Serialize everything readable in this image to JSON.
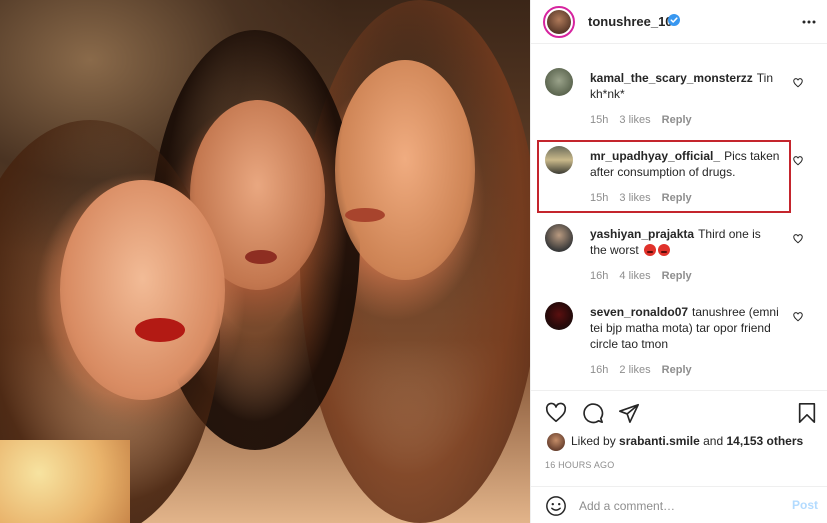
{
  "post": {
    "username": "tonushree_10",
    "verified": true
  },
  "comments": [
    {
      "username": "kamal_the_scary_monsterzz",
      "text": "Tin kh*nk*",
      "time": "15h",
      "likes": "3 likes",
      "reply": "Reply"
    },
    {
      "username": "mr_upadhyay_official_",
      "text": "Pics taken after consumption of drugs.",
      "time": "15h",
      "likes": "3 likes",
      "reply": "Reply"
    },
    {
      "username": "yashiyan_prajakta",
      "text": "Third one is the worst",
      "emoji": "angry-face-emoji x2",
      "time": "16h",
      "likes": "4 likes",
      "reply": "Reply"
    },
    {
      "username": "seven_ronaldo07",
      "text": "tanushree (emni tei bjp matha mota) tar opor friend circle tao tmon",
      "time": "16h",
      "likes": "2 likes",
      "reply": "Reply"
    }
  ],
  "likes": {
    "prefix": "Liked by",
    "user": "srabanti.smile",
    "and": "and",
    "others": "14,153 others"
  },
  "timestamp": "16 HOURS AGO",
  "add_comment": {
    "placeholder": "Add a comment…",
    "post_label": "Post"
  },
  "colors": {
    "highlight_box": "#c4252d",
    "verified_blue": "#3897f0",
    "post_button_disabled": "#b3dbff",
    "meta_gray": "#8e8e8e"
  },
  "icons": {
    "header": [
      "verified-badge-icon",
      "more-options-icon"
    ],
    "actions": [
      "heart-icon",
      "comment-icon",
      "share-icon",
      "bookmark-icon"
    ],
    "input": "emoji-smile-icon"
  }
}
